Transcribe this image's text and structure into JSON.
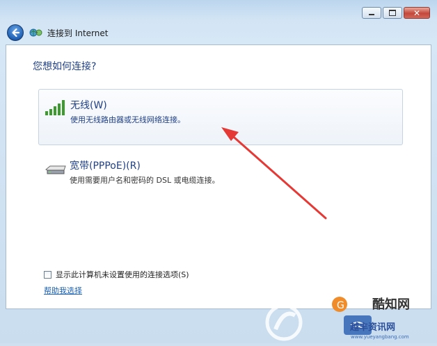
{
  "window": {
    "nav_title": "连接到 Internet",
    "minimize_icon": "minimize-icon",
    "maximize_icon": "maximize-icon",
    "close_icon": "close-icon"
  },
  "page": {
    "heading": "您想如何连接?"
  },
  "options": [
    {
      "title": "无线(W)",
      "description": "使用无线路由器或无线网络连接。",
      "icon": "wireless-signal-icon"
    },
    {
      "title": "宽带(PPPoE)(R)",
      "description": "使用需要用户名和密码的 DSL 或电缆连接。",
      "icon": "broadband-modem-icon"
    }
  ],
  "footer": {
    "checkbox_label": "显示此计算机未设置使用的连接选项(S)",
    "checkbox_checked": false,
    "help_link": "帮助我选择"
  },
  "annotation": {
    "arrow_color": "#e53935"
  },
  "watermark": {
    "logo_text": "酷知网",
    "site_text": "越丰资讯网",
    "url_text": "www.yueyangbang.com"
  },
  "colors": {
    "heading": "#1f3f86",
    "link": "#1a5fb4",
    "frame": "#cfe1f1"
  }
}
